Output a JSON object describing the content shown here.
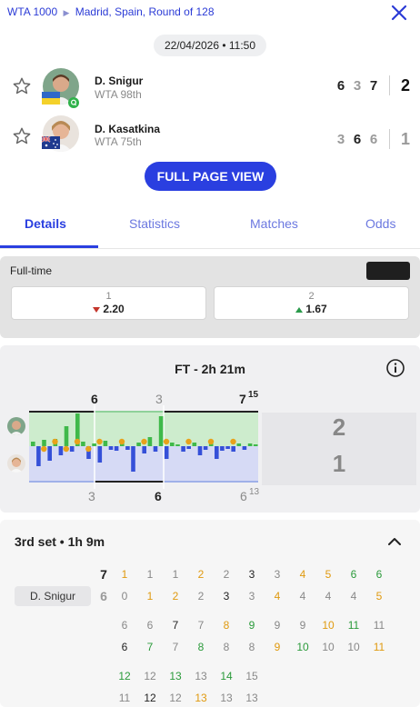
{
  "header": {
    "competition": "WTA 1000",
    "location": "Madrid, Spain, Round of 128",
    "datetime": "22/04/2026 • 11:50"
  },
  "players": [
    {
      "name": "D. Snigur",
      "rank": "WTA 98th",
      "set_scores": [
        "6",
        "3",
        "7"
      ],
      "set_won_flags": [
        true,
        false,
        true
      ],
      "sets_total": "2",
      "flag": "ukraine"
    },
    {
      "name": "D. Kasatkina",
      "rank": "WTA 75th",
      "set_scores": [
        "3",
        "6",
        "6"
      ],
      "set_won_flags": [
        false,
        true,
        false
      ],
      "sets_total": "1",
      "flag": "australia"
    }
  ],
  "buttons": {
    "full_page_view": "FULL PAGE VIEW"
  },
  "tabs": [
    {
      "label": "Details",
      "active": true
    },
    {
      "label": "Statistics",
      "active": false
    },
    {
      "label": "Matches",
      "active": false
    },
    {
      "label": "Odds",
      "active": false
    }
  ],
  "odds": {
    "label": "Full-time",
    "home": {
      "label": "1",
      "value": "2.20",
      "trend": "down"
    },
    "away": {
      "label": "2",
      "value": "1.67",
      "trend": "up"
    }
  },
  "momentum": {
    "title": "FT - 2h 21m",
    "top_markers": [
      {
        "text": "6",
        "bold": true
      },
      {
        "text": "3",
        "bold": false
      },
      {
        "text": "7",
        "sup": "15",
        "bold": true
      }
    ],
    "bottom_markers": [
      {
        "text": "3",
        "bold": false
      },
      {
        "text": "6",
        "bold": true
      },
      {
        "text": "6",
        "sup": "13",
        "bold": false
      }
    ],
    "sets_summary": [
      "2",
      "1"
    ],
    "colors": {
      "top_fill": "#cdeccd",
      "bottom_fill": "#d6daf5",
      "bar_green": "#3fb94a",
      "bar_blue": "#3550d8",
      "break": "#e8a21b"
    }
  },
  "third_set": {
    "title": "3rd set • 1h 9m",
    "player_chip": "D. Snigur",
    "final": [
      "7",
      "6"
    ],
    "rows": [
      [
        {
          "t": "1",
          "c": "#e09a10"
        },
        {
          "t": "1",
          "c": "#888"
        },
        {
          "t": "1",
          "c": "#888"
        },
        {
          "t": "2",
          "c": "#e09a10"
        },
        {
          "t": "2",
          "c": "#888"
        },
        {
          "t": "3",
          "c": "#222"
        },
        {
          "t": "3",
          "c": "#888"
        },
        {
          "t": "4",
          "c": "#e09a10"
        },
        {
          "t": "5",
          "c": "#e09a10"
        },
        {
          "t": "6",
          "c": "#2a9a3a"
        },
        {
          "t": "6",
          "c": "#2a9a3a"
        }
      ],
      [
        {
          "t": "0",
          "c": "#888"
        },
        {
          "t": "1",
          "c": "#e09a10"
        },
        {
          "t": "2",
          "c": "#e09a10"
        },
        {
          "t": "2",
          "c": "#888"
        },
        {
          "t": "3",
          "c": "#222"
        },
        {
          "t": "3",
          "c": "#888"
        },
        {
          "t": "4",
          "c": "#e09a10"
        },
        {
          "t": "4",
          "c": "#888"
        },
        {
          "t": "4",
          "c": "#888"
        },
        {
          "t": "4",
          "c": "#888"
        },
        {
          "t": "5",
          "c": "#e09a10"
        }
      ],
      [
        {
          "t": "6",
          "c": "#888"
        },
        {
          "t": "6",
          "c": "#888"
        },
        {
          "t": "7",
          "c": "#222"
        },
        {
          "t": "7",
          "c": "#888"
        },
        {
          "t": "8",
          "c": "#e09a10"
        },
        {
          "t": "9",
          "c": "#2a9a3a"
        },
        {
          "t": "9",
          "c": "#888"
        },
        {
          "t": "9",
          "c": "#888"
        },
        {
          "t": "10",
          "c": "#e09a10"
        },
        {
          "t": "11",
          "c": "#2a9a3a"
        },
        {
          "t": "11",
          "c": "#888"
        }
      ],
      [
        {
          "t": "6",
          "c": "#222"
        },
        {
          "t": "7",
          "c": "#2a9a3a"
        },
        {
          "t": "7",
          "c": "#888"
        },
        {
          "t": "8",
          "c": "#2a9a3a"
        },
        {
          "t": "8",
          "c": "#888"
        },
        {
          "t": "8",
          "c": "#888"
        },
        {
          "t": "9",
          "c": "#e09a10"
        },
        {
          "t": "10",
          "c": "#2a9a3a"
        },
        {
          "t": "10",
          "c": "#888"
        },
        {
          "t": "10",
          "c": "#888"
        },
        {
          "t": "11",
          "c": "#e09a10"
        }
      ],
      [
        {
          "t": "12",
          "c": "#2a9a3a"
        },
        {
          "t": "12",
          "c": "#888"
        },
        {
          "t": "13",
          "c": "#2a9a3a"
        },
        {
          "t": "13",
          "c": "#888"
        },
        {
          "t": "14",
          "c": "#2a9a3a"
        },
        {
          "t": "15",
          "c": "#888"
        }
      ],
      [
        {
          "t": "11",
          "c": "#888"
        },
        {
          "t": "12",
          "c": "#222"
        },
        {
          "t": "12",
          "c": "#888"
        },
        {
          "t": "13",
          "c": "#e09a10"
        },
        {
          "t": "13",
          "c": "#888"
        },
        {
          "t": "13",
          "c": "#888"
        }
      ]
    ]
  }
}
